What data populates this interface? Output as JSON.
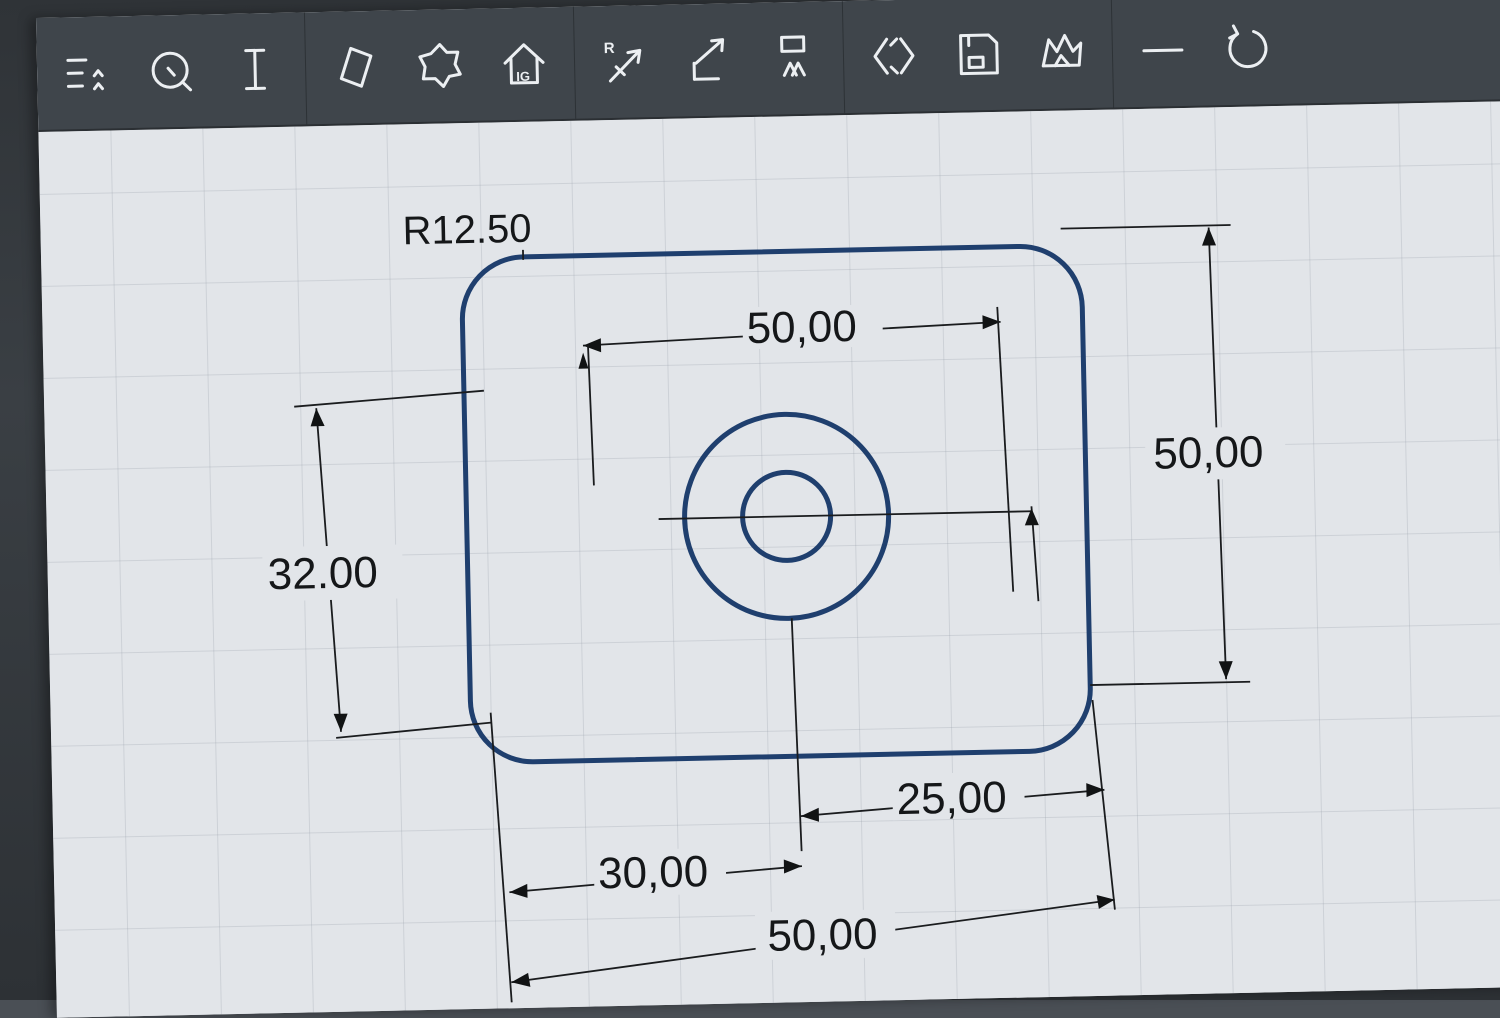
{
  "toolbar": {
    "groups": [
      {
        "tools": [
          "menu-icon",
          "search-icon",
          "text-cursor-icon"
        ]
      },
      {
        "tools": [
          "diamond-icon",
          "octagon-icon",
          "house-icon"
        ]
      },
      {
        "tools": [
          "radius-tool-icon",
          "line-angle-icon",
          "trim-icon"
        ]
      },
      {
        "tools": [
          "fit-view-icon",
          "save-icon",
          "fill-icon"
        ]
      },
      {
        "tools": [
          "minimize-icon",
          "refresh-icon"
        ]
      }
    ],
    "radius_letter": "R",
    "house_label": "IG"
  },
  "drawing": {
    "radius_label": "R12.50",
    "dim_top_width": "50,00",
    "dim_height_right": "50,00",
    "dim_height_left": "32.00",
    "dim_bottom_right": "25,00",
    "dim_bottom_left": "30,00",
    "dim_bottom_total": "50,00",
    "colors": {
      "geometry": "#1f3f6e",
      "dimension": "#1a1c1e"
    }
  }
}
